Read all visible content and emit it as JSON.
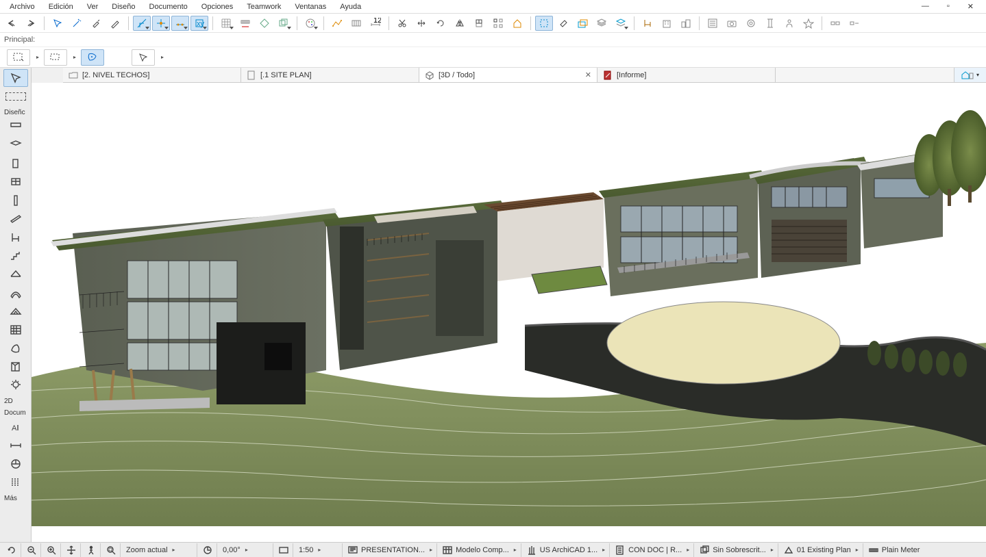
{
  "menu": {
    "items": [
      "Archivo",
      "Edición",
      "Ver",
      "Diseño",
      "Documento",
      "Opciones",
      "Teamwork",
      "Ventanas",
      "Ayuda"
    ]
  },
  "toolbar": {
    "principal_label": "Principal:"
  },
  "tabs": {
    "items": [
      {
        "label": "[2. NIVEL TECHOS]",
        "closable": false,
        "icon": "folder"
      },
      {
        "label": "[.1 SITE PLAN]",
        "closable": false,
        "icon": "sheet"
      },
      {
        "label": "[3D / Todo]",
        "closable": true,
        "icon": "cube",
        "active": true
      },
      {
        "label": "[Informe]",
        "closable": false,
        "icon": "report"
      }
    ]
  },
  "left_panel": {
    "section_design": "Diseñc",
    "section_2d": "2D",
    "section_doc": "Docum",
    "section_more": "Más"
  },
  "status": {
    "zoom_label": "Zoom actual",
    "angle": "0,00°",
    "scale": "1:50",
    "presentation": "PRESENTATION...",
    "model": "Modelo Comp...",
    "library": "US ArchiCAD 1...",
    "condoc": "CON DOC | R...",
    "override": "Sin Sobrescrit...",
    "plan": "01 Existing Plan",
    "meter": "Plain Meter"
  }
}
